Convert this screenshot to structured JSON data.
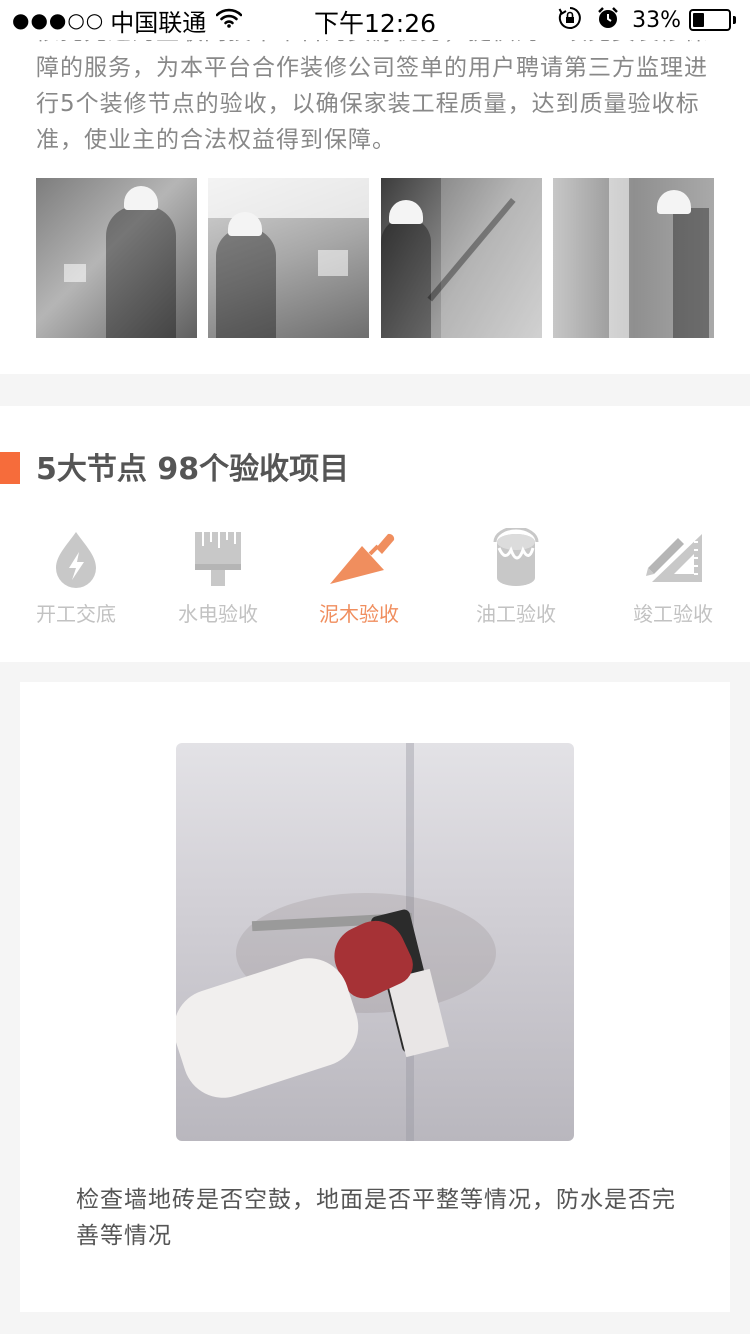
{
  "status_bar": {
    "signal_dots": "●●●○○",
    "carrier": "中国联通",
    "time": "下午12:26",
    "battery_percent": "33%",
    "battery_level": 0.33,
    "icons": [
      "wifi-icon",
      "rotation-lock-icon",
      "alarm-icon",
      "battery-icon"
    ]
  },
  "intro": {
    "text": "依托先进的互联网技术平台的资源优势，提供的一项免费装修保障的服务，为本平台合作装修公司签单的用户聘请第三方监理进行5个装修节点的验收，以确保家装工程质量，达到质量验收标准，使业主的合法权益得到保障。",
    "photos": [
      "worker-checking-socket",
      "worker-checking-kitchen-wall",
      "worker-measuring-wall",
      "bathroom-fixtures"
    ]
  },
  "nodes_section": {
    "title": "5大节点 98个验收项目",
    "accent_color": "#f66c3b",
    "active_color": "#f08e5e",
    "inactive_color": "#c8c8c8",
    "tabs": [
      {
        "label": "开工交底",
        "icon": "water-drop-lightning-icon",
        "active": false
      },
      {
        "label": "水电验收",
        "icon": "paint-brush-icon",
        "active": false
      },
      {
        "label": "泥木验收",
        "icon": "trowel-icon",
        "active": true
      },
      {
        "label": "油工验收",
        "icon": "paint-bucket-icon",
        "active": false
      },
      {
        "label": "竣工验收",
        "icon": "ruler-pencil-icon",
        "active": false
      }
    ]
  },
  "detail_card": {
    "image": "inspector-checking-wall-tile-with-tool",
    "caption": "检查墙地砖是否空鼓，地面是否平整等情况，防水是否完善等情况"
  }
}
